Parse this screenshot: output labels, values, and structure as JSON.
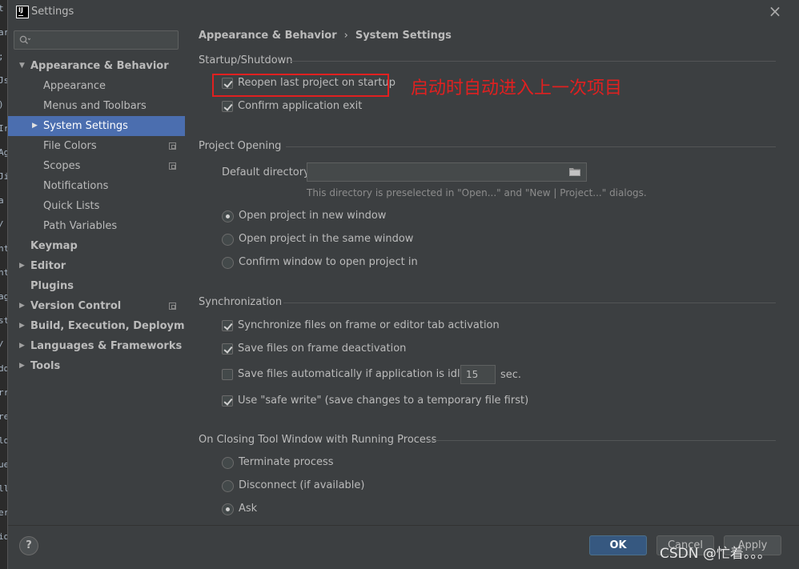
{
  "window": {
    "title": "Settings"
  },
  "search": {
    "placeholder": ""
  },
  "sidebar": {
    "items": [
      {
        "label": "Appearance & Behavior",
        "level": 0,
        "bold": true,
        "expanded": true
      },
      {
        "label": "Appearance",
        "level": 1
      },
      {
        "label": "Menus and Toolbars",
        "level": 1
      },
      {
        "label": "System Settings",
        "level": 1,
        "selected": true,
        "collapsed": true
      },
      {
        "label": "File Colors",
        "level": 1,
        "project_icon": true
      },
      {
        "label": "Scopes",
        "level": 1,
        "project_icon": true
      },
      {
        "label": "Notifications",
        "level": 1
      },
      {
        "label": "Quick Lists",
        "level": 1
      },
      {
        "label": "Path Variables",
        "level": 1
      },
      {
        "label": "Keymap",
        "level": 0,
        "bold": true
      },
      {
        "label": "Editor",
        "level": 0,
        "bold": true,
        "collapsed": true
      },
      {
        "label": "Plugins",
        "level": 0,
        "bold": true
      },
      {
        "label": "Version Control",
        "level": 0,
        "bold": true,
        "collapsed": true,
        "project_icon": true
      },
      {
        "label": "Build, Execution, Deployment",
        "level": 0,
        "bold": true,
        "collapsed": true
      },
      {
        "label": "Languages & Frameworks",
        "level": 0,
        "bold": true,
        "collapsed": true
      },
      {
        "label": "Tools",
        "level": 0,
        "bold": true,
        "collapsed": true
      }
    ]
  },
  "breadcrumb": {
    "parent": "Appearance & Behavior",
    "separator": "›",
    "current": "System Settings"
  },
  "startup": {
    "title": "Startup/Shutdown",
    "reopen_label": "Reopen last project on startup",
    "reopen_checked": true,
    "confirm_exit_label": "Confirm application exit",
    "confirm_exit_checked": true,
    "annotation": "启动时自动进入上一次项目"
  },
  "project_opening": {
    "title": "Project Opening",
    "default_dir_label": "Default directory:",
    "default_dir_value": "",
    "hint": "This directory is preselected in \"Open...\" and \"New | Project...\" dialogs.",
    "options": [
      {
        "label": "Open project in new window",
        "checked": true
      },
      {
        "label": "Open project in the same window",
        "checked": false
      },
      {
        "label": "Confirm window to open project in",
        "checked": false
      }
    ]
  },
  "sync": {
    "title": "Synchronization",
    "sync_files_label": "Synchronize files on frame or editor tab activation",
    "sync_files_checked": true,
    "save_deactivation_label": "Save files on frame deactivation",
    "save_deactivation_checked": true,
    "save_idle_label": "Save files automatically if application is idle for",
    "save_idle_checked": false,
    "idle_value": "15",
    "idle_unit": "sec.",
    "safe_write_label": "Use \"safe write\" (save changes to a temporary file first)",
    "safe_write_checked": true
  },
  "closing": {
    "title": "On Closing Tool Window with Running Process",
    "options": [
      {
        "label": "Terminate process",
        "checked": false
      },
      {
        "label": "Disconnect (if available)",
        "checked": false
      },
      {
        "label": "Ask",
        "checked": true
      }
    ]
  },
  "footer": {
    "help_label": "?",
    "ok_label": "OK",
    "cancel_label": "Cancel",
    "apply_label": "Apply",
    "watermark": "CSDN @忙着。。。"
  },
  "colors": {
    "background": "#3c3f41",
    "selection": "#4b6eaf",
    "ok_button": "#365880",
    "annotation": "#e02020"
  },
  "editor_strip": [
    "t",
    "ar",
    ";",
    "Js",
    ")",
    "Ir",
    "Ag",
    "Ji",
    "a",
    "/",
    "nt",
    "nt",
    "ag",
    "st",
    "/",
    "dd",
    "rr",
    "re",
    "ld",
    "ue",
    "ll",
    "er",
    "id"
  ]
}
